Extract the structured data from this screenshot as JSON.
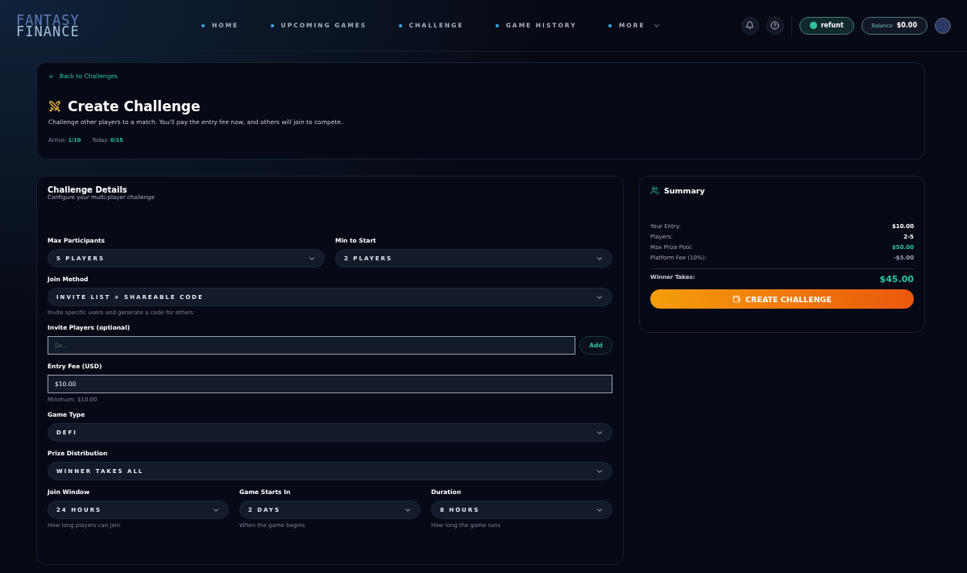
{
  "brand": {
    "line1": "FANTASY",
    "line2": "FINANCE"
  },
  "nav": [
    {
      "label": "HOME",
      "dropdown": false
    },
    {
      "label": "UPCOMING GAMES",
      "dropdown": false
    },
    {
      "label": "CHALLENGE",
      "dropdown": false
    },
    {
      "label": "GAME HISTORY",
      "dropdown": false
    },
    {
      "label": "MORE",
      "dropdown": true
    }
  ],
  "account": {
    "user": "refunt",
    "balance_label": "Balance",
    "balance": "$0.00"
  },
  "intro": {
    "back": "Back to Challenges",
    "title": "Create Challenge",
    "description": "Challenge other players to a match. You'll pay the entry fee now, and others will join to compete.",
    "stats": [
      {
        "label": "Active:",
        "value": "1/10"
      },
      {
        "label": "Today:",
        "value": "0/15"
      }
    ]
  },
  "form": {
    "title": "Challenge Details",
    "subtitle": "Configure your multi-player challenge",
    "rows": [
      {
        "fields": [
          {
            "kind": "select",
            "label": "Max Participants",
            "value": "5 PLAYERS"
          },
          {
            "kind": "select",
            "label": "Min to Start",
            "value": "2 PLAYERS"
          }
        ]
      },
      {
        "fields": [
          {
            "kind": "select",
            "label": "Join Method",
            "value": "INVITE LIST + SHAREABLE CODE",
            "hint": "Invite specific users and generate a code for others"
          }
        ]
      },
      {
        "fields": [
          {
            "kind": "input",
            "label": "Invite Players (optional)",
            "placeholder": "0x...",
            "button": "Add"
          }
        ]
      },
      {
        "fields": [
          {
            "kind": "input",
            "label": "Entry Fee (USD)",
            "value": "$10.00",
            "hint": "Minimum: $10.00"
          }
        ]
      },
      {
        "fields": [
          {
            "kind": "select",
            "label": "Game Type",
            "value": "DEFI"
          }
        ]
      },
      {
        "fields": [
          {
            "kind": "select",
            "label": "Prize Distribution",
            "value": "WINNER TAKES ALL"
          }
        ]
      },
      {
        "fields": [
          {
            "kind": "select",
            "label": "Join Window",
            "value": "24 HOURS",
            "hint": "How long players can join"
          },
          {
            "kind": "select",
            "label": "Game Starts In",
            "value": "2 DAYS",
            "hint": "When the game begins"
          },
          {
            "kind": "select",
            "label": "Duration",
            "value": "8 HOURS",
            "hint": "How long the game runs"
          }
        ]
      }
    ]
  },
  "summary": {
    "title": "Summary",
    "rows": [
      {
        "label": "Your Entry:",
        "value": "$10.00",
        "color": "#ffffff"
      },
      {
        "label": "Players:",
        "value": "2-5",
        "color": "#ffffff"
      },
      {
        "label": "Max Prize Pool:",
        "value": "$50.00",
        "color": "#2ec4a0"
      },
      {
        "label": "Platform Fee (10%):",
        "value": "-$5.00",
        "color": "#9aa3b2"
      }
    ],
    "total_label": "Winner Takes:",
    "total": "$45.00",
    "button": "CREATE CHALLENGE"
  }
}
